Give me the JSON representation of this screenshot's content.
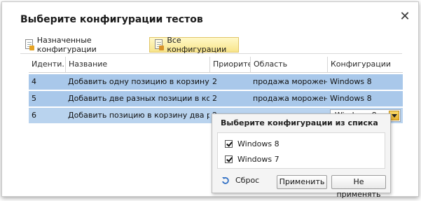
{
  "dialog": {
    "title": "Выберите конфигурации тестов",
    "close_glyph": "✕"
  },
  "toolbar": {
    "assigned_label": "Назначенные конфигурации",
    "all_label": "Все конфигурации"
  },
  "grid": {
    "headers": [
      "Иденти...",
      "Название",
      "Приоритет",
      "Область",
      "Конфигурации"
    ],
    "rows": [
      {
        "id": "4",
        "name": "Добавить одну позицию в корзину",
        "priority": "2",
        "area": "продажа мороженого",
        "config": "Windows 8"
      },
      {
        "id": "5",
        "name": "Добавить две разных позиции в корзину",
        "priority": "2",
        "area": "продажа мороженого",
        "config": "Windows 8"
      },
      {
        "id": "6",
        "name": "Добавить позицию в корзину два раза",
        "priority": "2",
        "area": "продажа мороженого",
        "config": "Windows 8"
      }
    ]
  },
  "popup": {
    "title": "Выберите конфигурации из списка",
    "items": [
      {
        "label": "Windows 8",
        "checked": true
      },
      {
        "label": "Windows 7",
        "checked": true
      }
    ],
    "reset_label": "Сброс",
    "apply_label": "Применить",
    "cancel_label": "Не применять"
  },
  "colors": {
    "selected_row": "#a9c8ea",
    "active_toolbar": "#f8e58a",
    "combo_arrow": "#e7b12d"
  }
}
